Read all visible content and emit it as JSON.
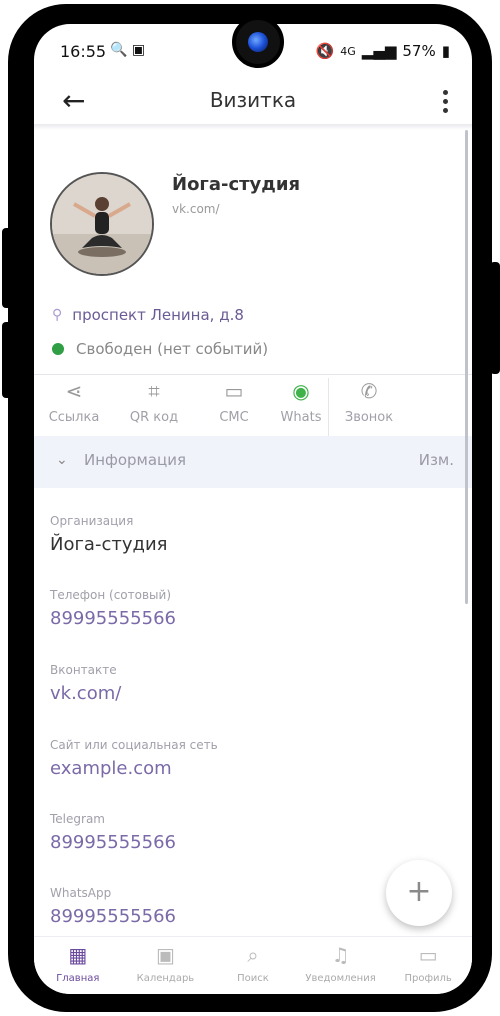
{
  "status_bar": {
    "time": "16:55",
    "left_icons": "🔍 ▣",
    "network": "4G",
    "battery": "57%"
  },
  "appbar": {
    "title": "Визитка"
  },
  "profile": {
    "name": "Йога-студия",
    "subtitle": "vk.com/",
    "address": "проспект Ленина, д.8",
    "availability": "Свободен (нет событий)"
  },
  "actions": [
    {
      "label": "Ссылка",
      "icon": "share-icon"
    },
    {
      "label": "QR код",
      "icon": "qr-code-icon"
    },
    {
      "label": "СМС",
      "icon": "message-icon"
    },
    {
      "label": "Whats",
      "icon": "whatsapp-icon"
    },
    {
      "label": "Звонок",
      "icon": "phone-icon"
    }
  ],
  "info_section": {
    "label": "Информация",
    "edit_label": "Изм."
  },
  "fields": [
    {
      "label": "Организация",
      "value": "Йога-студия"
    },
    {
      "label": "Телефон  (сотовый)",
      "value": "89995555566"
    },
    {
      "label": "Вконтакте",
      "value": "vk.com/"
    },
    {
      "label": "Сайт или социальная сеть",
      "value": "example.com"
    },
    {
      "label": "Telegram",
      "value": "89995555566"
    },
    {
      "label": "WhatsApp",
      "value": "89995555566"
    }
  ],
  "bottom_nav": [
    {
      "label": "Главная",
      "icon": "home-grid-icon"
    },
    {
      "label": "Календарь",
      "icon": "calendar-icon"
    },
    {
      "label": "Поиск",
      "icon": "search-icon"
    },
    {
      "label": "Уведомления",
      "icon": "bell-icon"
    },
    {
      "label": "Профиль",
      "icon": "profile-card-icon"
    }
  ],
  "colors": {
    "accent": "#7b6aa8",
    "status_green": "#2f9e44",
    "info_bar_bg": "#f1f3fa"
  }
}
